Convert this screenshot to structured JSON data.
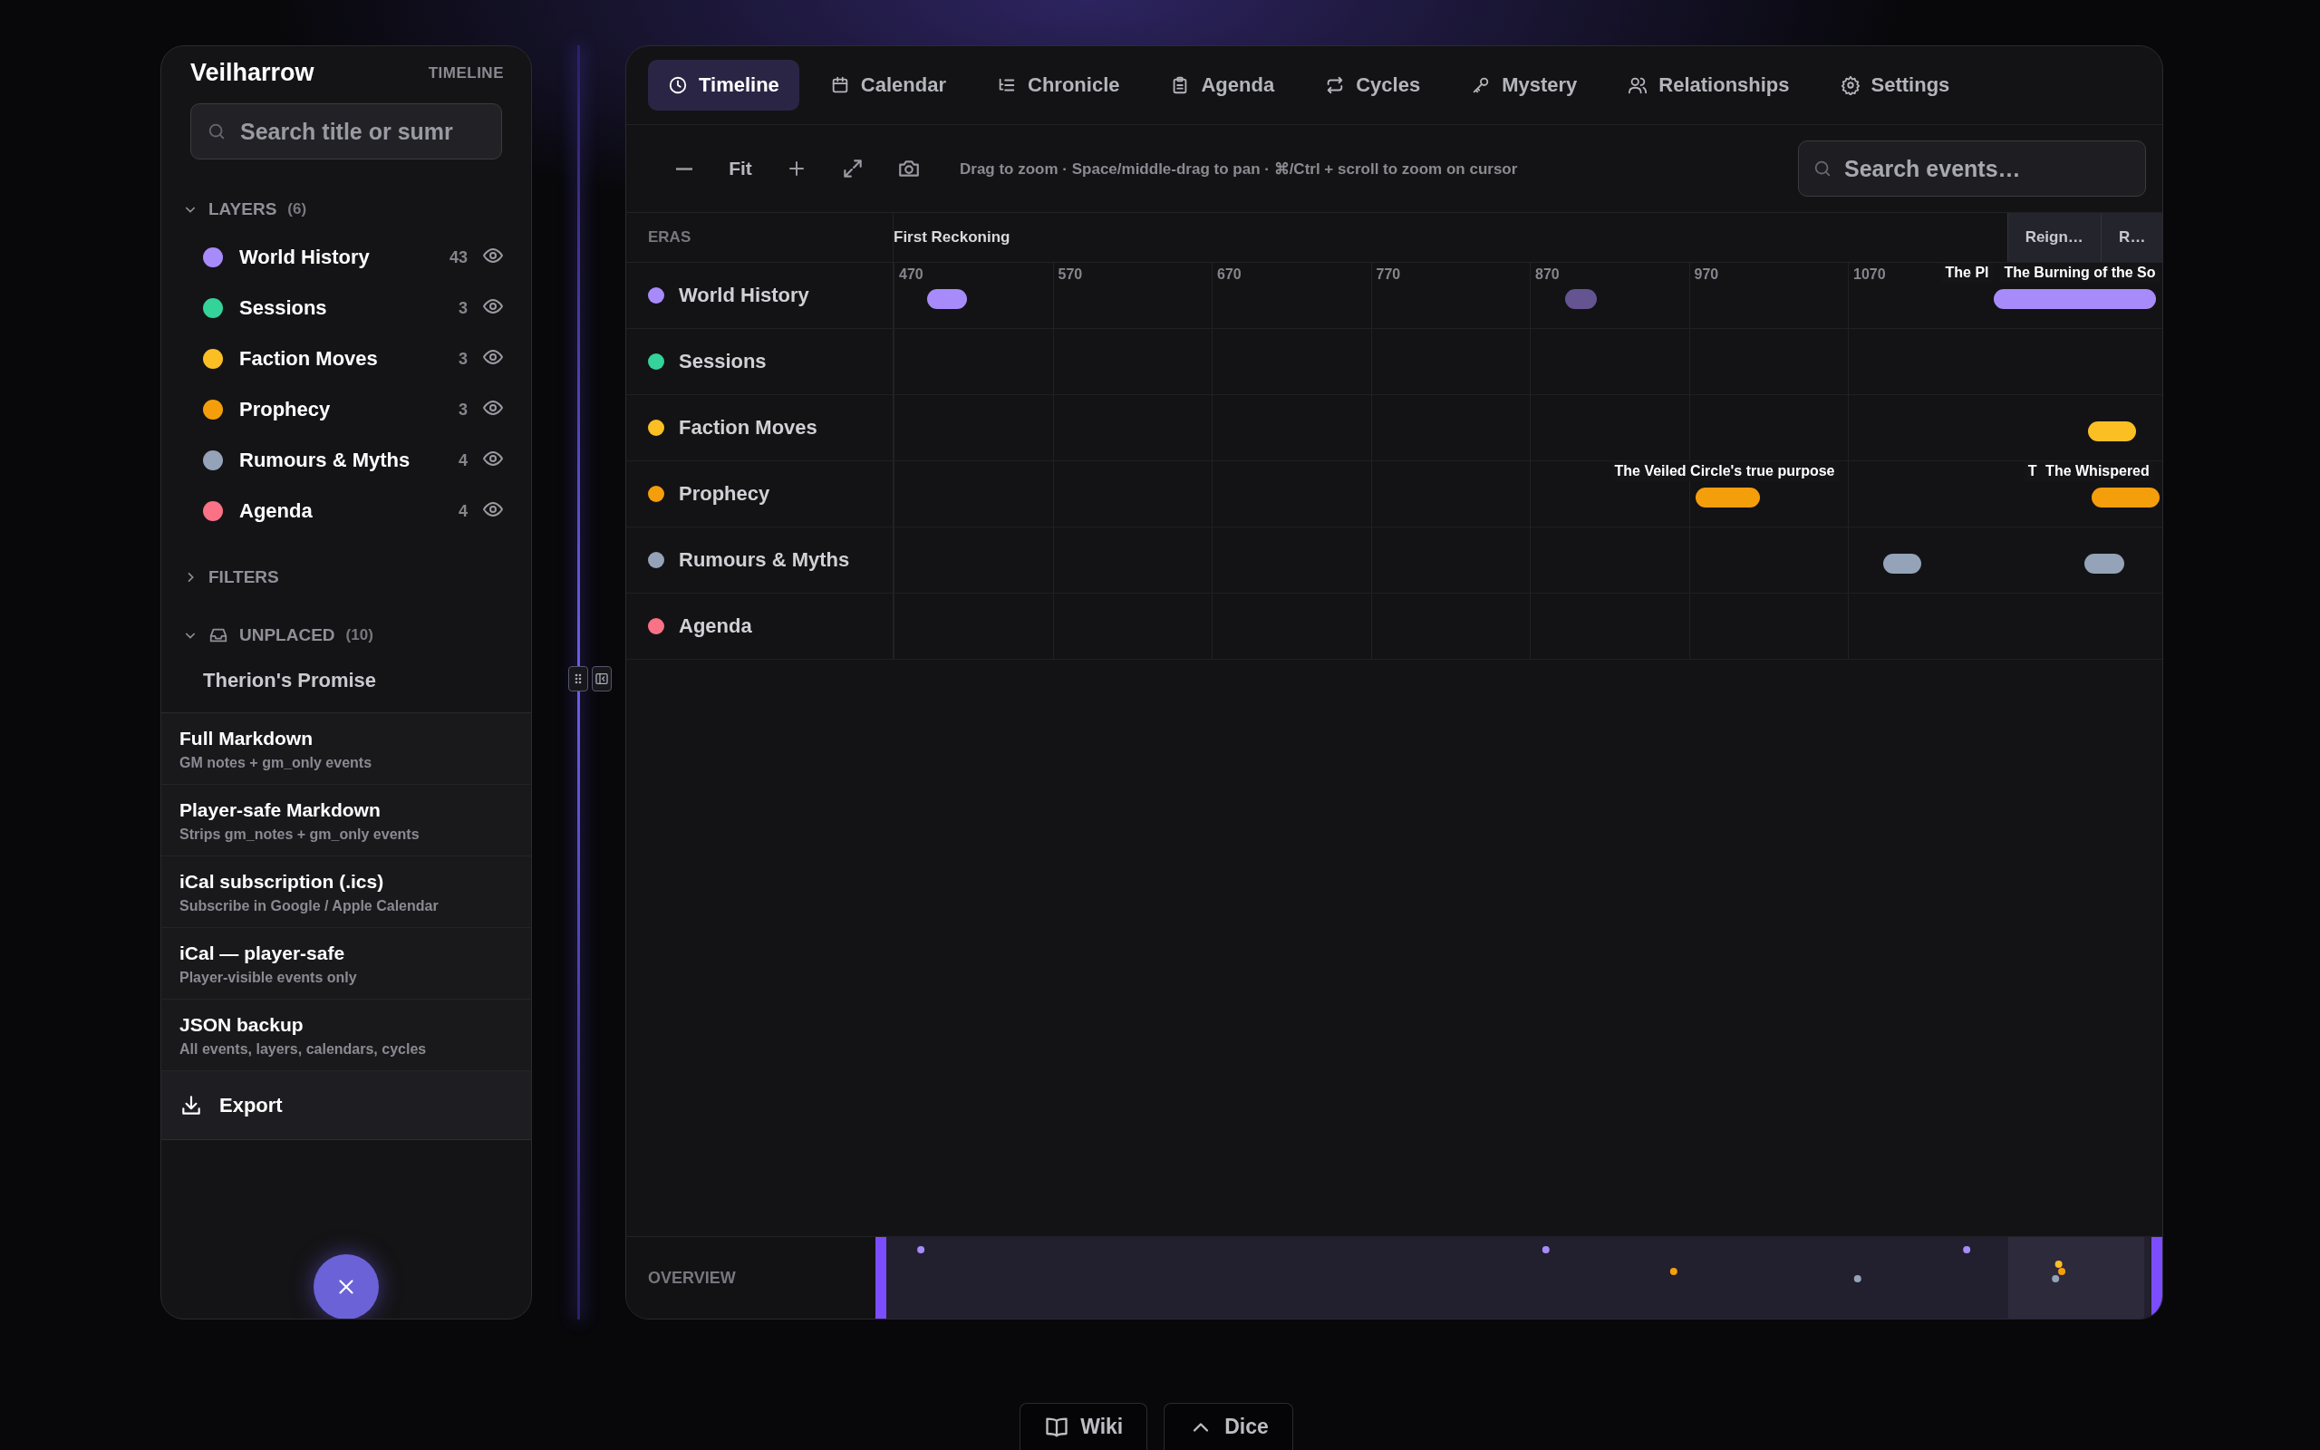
{
  "sidebar": {
    "title": "Veilharrow",
    "mode": "TIMELINE",
    "search": {
      "placeholder": "Search title or sumr"
    },
    "layers": {
      "label": "LAYERS",
      "count": "(6)",
      "expanded": true,
      "items": [
        {
          "name": "World History",
          "color": "#a78bfa",
          "count": "43",
          "visible": true
        },
        {
          "name": "Sessions",
          "color": "#34d399",
          "count": "3",
          "visible": true
        },
        {
          "name": "Faction Moves",
          "color": "#fbbf24",
          "count": "3",
          "visible": true
        },
        {
          "name": "Prophecy",
          "color": "#f59e0b",
          "count": "3",
          "visible": true
        },
        {
          "name": "Rumours & Myths",
          "color": "#94a3b8",
          "count": "4",
          "visible": true
        },
        {
          "name": "Agenda",
          "color": "#fb7185",
          "count": "4",
          "visible": true
        }
      ]
    },
    "filters": {
      "label": "FILTERS",
      "expanded": false
    },
    "unplaced": {
      "label": "UNPLACED",
      "count": "(10)",
      "expanded": true,
      "items": [
        "Therion's Promise"
      ]
    },
    "export_menu": {
      "items": [
        {
          "title": "Full Markdown",
          "description": "GM notes + gm_only events"
        },
        {
          "title": "Player-safe Markdown",
          "description": "Strips gm_notes + gm_only events"
        },
        {
          "title": "iCal subscription (.ics)",
          "description": "Subscribe in Google / Apple Calendar"
        },
        {
          "title": "iCal — player-safe",
          "description": "Player-visible events only"
        },
        {
          "title": "JSON backup",
          "description": "All events, layers, calendars, cycles"
        }
      ],
      "button": "Export"
    }
  },
  "tabs": [
    {
      "label": "Timeline",
      "kind": "clock",
      "selected": true
    },
    {
      "label": "Calendar",
      "kind": "calendar",
      "selected": false
    },
    {
      "label": "Chronicle",
      "kind": "list",
      "selected": false
    },
    {
      "label": "Agenda",
      "kind": "clipboard",
      "selected": false
    },
    {
      "label": "Cycles",
      "kind": "cycle",
      "selected": false
    },
    {
      "label": "Mystery",
      "kind": "key",
      "selected": false
    },
    {
      "label": "Relationships",
      "kind": "people",
      "selected": false
    },
    {
      "label": "Settings",
      "kind": "gear",
      "selected": false
    }
  ],
  "toolbar": {
    "fit": "Fit",
    "hint": "Drag to zoom · Space/middle-drag to pan · ⌘/Ctrl + scroll to zoom on cursor",
    "search": {
      "placeholder": "Search events…"
    }
  },
  "timeline": {
    "eras_label": "ERAS",
    "eras": [
      {
        "name": "First Reckoning",
        "shaded": false
      },
      {
        "name": "Reign…",
        "shaded": true
      },
      {
        "name": "R…",
        "shaded": true
      }
    ],
    "ticks": [
      "470",
      "570",
      "670",
      "770",
      "870",
      "970",
      "1070"
    ],
    "rows": [
      {
        "name": "World History",
        "color": "#a78bfa",
        "labels": [
          "The Pl",
          "The Burning of the So"
        ]
      },
      {
        "name": "Sessions",
        "color": "#34d399"
      },
      {
        "name": "Faction Moves",
        "color": "#fbbf24"
      },
      {
        "name": "Prophecy",
        "color": "#f59e0b",
        "labels": [
          "The Veiled Circle's true purpose",
          "T",
          "The Whispered"
        ]
      },
      {
        "name": "Rumours & Myths",
        "color": "#94a3b8"
      },
      {
        "name": "Agenda",
        "color": "#fb7185"
      }
    ]
  },
  "overview": {
    "label": "OVERVIEW"
  },
  "bottom_bar": [
    {
      "label": "Wiki",
      "kind": "book"
    },
    {
      "label": "Dice",
      "kind": "caret"
    }
  ]
}
